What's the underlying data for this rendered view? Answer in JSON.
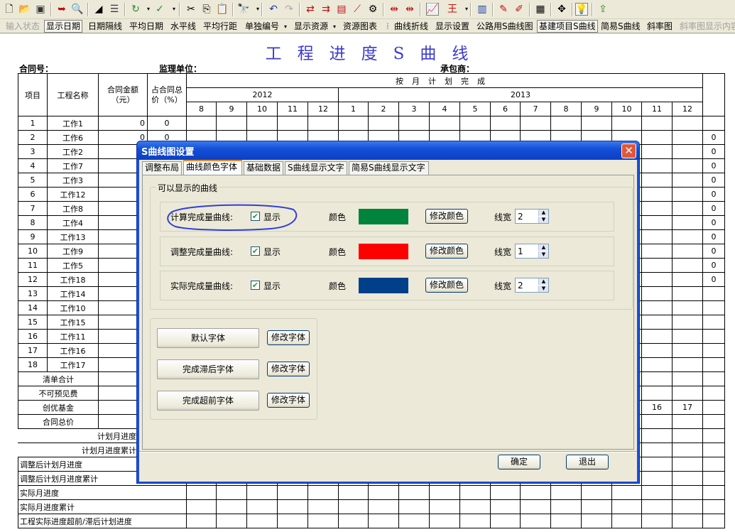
{
  "toolbar1": {
    "icons": [
      "new-file-icon",
      "open-folder-icon",
      "save-icon",
      "exit-icon",
      "print-preview-icon",
      "triangle-icon",
      "list-icon",
      "refresh-icon",
      "check-icon",
      "cut-icon",
      "copy-icon",
      "paste-icon",
      "find-icon",
      "undo-icon",
      "redo-icon",
      "link-icon",
      "split-icon",
      "bar-icon",
      "curve-icon",
      "tool-icon",
      "spread-icon",
      "spread2-icon",
      "chart-icon",
      "text-icon",
      "barchart-icon",
      "pen-icon",
      "edit-icon",
      "film-icon",
      "move-icon",
      "bulb-icon",
      "export-icon"
    ]
  },
  "toolbar2": {
    "input_status": "输入状态",
    "show_date": "显示日期",
    "date_interval": "日期隔线",
    "avg_date": "平均日期",
    "horizontal": "水平线",
    "avg_row_height": "平均行距",
    "single_number": "单独编号",
    "show_resource": "显示资源",
    "resource_chart": "资源图表",
    "curve_line": "曲线折线",
    "display_settings": "显示设置",
    "highway_s": "公路用S曲线图",
    "infra_s": "基建项目S曲线",
    "simple_s": "简易S曲线",
    "slope": "斜率图",
    "slope_text": "斜率图显示内容"
  },
  "doc": {
    "title": "工程进度S曲线",
    "contract_no": "合同号：",
    "supervisor": "监理单位：",
    "contractor": "承包商："
  },
  "table": {
    "h_item": "项目",
    "h_name": "工程名称",
    "h_amount": "合同金额（元）",
    "h_percent": "占合同总价（%）",
    "h_plan": "按月计划完成",
    "year1": "2012",
    "year2": "2013",
    "months1": [
      "8",
      "9",
      "10",
      "11",
      "12"
    ],
    "months2": [
      "1",
      "2",
      "3",
      "4",
      "5",
      "6",
      "7",
      "8",
      "9",
      "10",
      "11",
      "12"
    ],
    "rows": [
      {
        "n": "1",
        "name": "工作1",
        "amt": "0",
        "pct": "0"
      },
      {
        "n": "2",
        "name": "工作6",
        "amt": "0",
        "pct": "0"
      },
      {
        "n": "3",
        "name": "工作2",
        "amt": "",
        "pct": ""
      },
      {
        "n": "4",
        "name": "工作7",
        "amt": "",
        "pct": ""
      },
      {
        "n": "5",
        "name": "工作3",
        "amt": "",
        "pct": ""
      },
      {
        "n": "6",
        "name": "工作12",
        "amt": "",
        "pct": ""
      },
      {
        "n": "7",
        "name": "工作8",
        "amt": "",
        "pct": ""
      },
      {
        "n": "8",
        "name": "工作4",
        "amt": "",
        "pct": ""
      },
      {
        "n": "9",
        "name": "工作13",
        "amt": "",
        "pct": ""
      },
      {
        "n": "10",
        "name": "工作9",
        "amt": "",
        "pct": ""
      },
      {
        "n": "11",
        "name": "工作5",
        "amt": "",
        "pct": ""
      },
      {
        "n": "12",
        "name": "工作18",
        "amt": "",
        "pct": ""
      },
      {
        "n": "13",
        "name": "工作14",
        "amt": "",
        "pct": ""
      },
      {
        "n": "14",
        "name": "工作10",
        "amt": "",
        "pct": ""
      },
      {
        "n": "15",
        "name": "工作15",
        "amt": "",
        "pct": ""
      },
      {
        "n": "16",
        "name": "工作11",
        "amt": "",
        "pct": ""
      },
      {
        "n": "17",
        "name": "工作16",
        "amt": "",
        "pct": ""
      },
      {
        "n": "18",
        "name": "工作17",
        "amt": "",
        "pct": ""
      }
    ],
    "right_zeros": [
      "0",
      "0",
      "0",
      "0",
      "0",
      "0",
      "0",
      "0",
      "0",
      "0",
      "0"
    ],
    "summary": {
      "bill_total": "清单合计",
      "unforeseen": "不可预见费",
      "excellence": "创优基金",
      "contract_total": "合同总价",
      "plan_month": "计划月进度",
      "plan_cum": "计划月进度累计",
      "adj_plan_month": "调整后计划月进度",
      "adj_plan_cum": "调整后计划月进度累计",
      "actual_month": "实际月进度",
      "actual_cum": "实际月进度累计",
      "ahead_behind": "工程实际进度超前/滞后计划进度"
    },
    "col_11_val": "16",
    "col_12_val": "17"
  },
  "dialog": {
    "title": "S曲线图设置",
    "tabs": [
      "调整布局",
      "曲线颜色字体",
      "基础数据",
      "S曲线显示文字",
      "简易S曲线显示文字"
    ],
    "group_title": "可以显示的曲线",
    "show": "显示",
    "color_label": "颜色",
    "modify_color": "修改颜色",
    "line_width_label": "线宽",
    "curves": [
      {
        "label": "计算完成量曲线:",
        "color": "#00843d",
        "width": "2"
      },
      {
        "label": "调整完成量曲线:",
        "color": "#ff0000",
        "width": "1"
      },
      {
        "label": "实际完成量曲线:",
        "color": "#003f8a",
        "width": "2"
      }
    ],
    "fonts": [
      {
        "label": "默认字体"
      },
      {
        "label": "完成滞后字体"
      },
      {
        "label": "完成超前字体"
      }
    ],
    "modify_font": "修改字体",
    "ok": "确定",
    "exit": "退出"
  },
  "colors": {
    "title_blue": "#3b3bd0",
    "annotation": "#2f3fd8",
    "xp_blue": "#0b3fc4"
  }
}
